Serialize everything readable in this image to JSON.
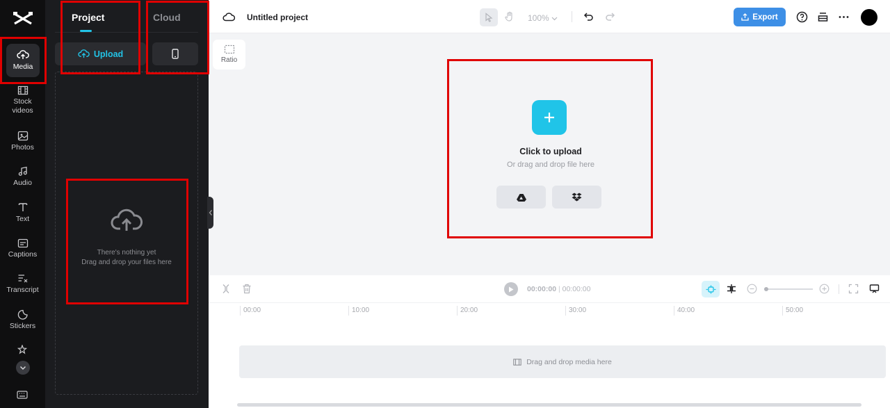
{
  "rail": {
    "items": [
      {
        "label": "Media"
      },
      {
        "label": "Stock videos"
      },
      {
        "label": "Photos"
      },
      {
        "label": "Audio"
      },
      {
        "label": "Text"
      },
      {
        "label": "Captions"
      },
      {
        "label": "Transcript"
      },
      {
        "label": "Stickers"
      }
    ]
  },
  "panel": {
    "tabs": [
      {
        "label": "Project"
      },
      {
        "label": "Cloud"
      }
    ],
    "upload_label": "Upload",
    "empty_line1": "There's nothing yet",
    "empty_line2": "Drag and drop your files here"
  },
  "topbar": {
    "project_title": "Untitled project",
    "zoom": "100%",
    "export_label": "Export"
  },
  "ratio_label": "Ratio",
  "canvas": {
    "title": "Click to upload",
    "subtitle": "Or drag and drop file here"
  },
  "timeline": {
    "current_time": "00:00:00",
    "total_time": "00:00:00",
    "ruler": [
      "00:00",
      "10:00",
      "20:00",
      "30:00",
      "40:00",
      "50:00"
    ],
    "track_hint": "Drag and drop media here"
  },
  "colors": {
    "accent": "#22c3e6",
    "export": "#3d8fe6",
    "highlight": "#e00000"
  }
}
